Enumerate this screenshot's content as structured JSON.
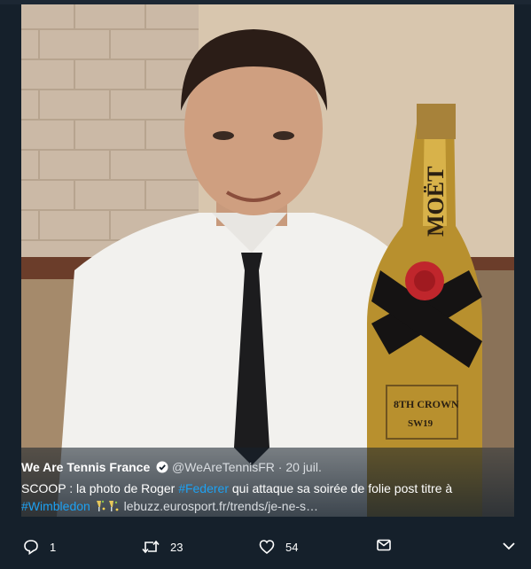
{
  "tweet": {
    "author_name": "We Are Tennis France",
    "handle": "@WeAreTennisFR",
    "separator": "·",
    "date": "20 juil.",
    "text_part1": "SCOOP : la photo de Roger ",
    "hashtag1": "#Federer",
    "text_part2": " qui attaque sa soirée de folie post titre à",
    "hashtag2": "#Wimbledon",
    "url": "lebuzz.eurosport.fr/trends/je-ne-s…"
  },
  "image": {
    "bottle_brand": "MOËT",
    "label_line1": "8TH CROWN",
    "label_line2": "SW19"
  },
  "actions": {
    "reply_count": "1",
    "retweet_count": "23",
    "like_count": "54"
  },
  "icons": {
    "verified": "verified-badge-icon",
    "reply": "reply-icon",
    "retweet": "retweet-icon",
    "like": "heart-icon",
    "dm": "envelope-icon",
    "more": "chevron-down-icon",
    "emoji": "champagne-emoji-icon"
  },
  "colors": {
    "background": "#15202b",
    "hashtag": "#1da1f2",
    "text": "#ffffff",
    "secondary": "#d9dde1"
  }
}
